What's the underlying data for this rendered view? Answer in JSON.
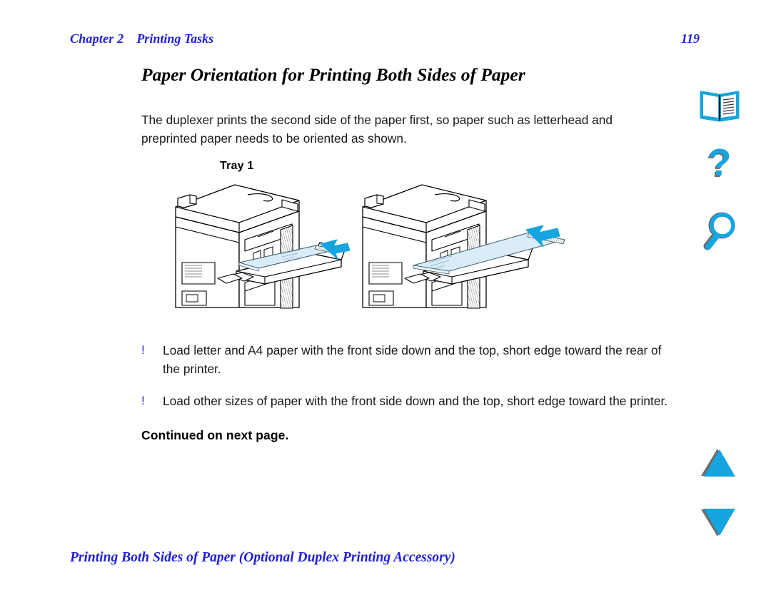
{
  "header": {
    "chapter": "Chapter 2",
    "section": "Printing Tasks",
    "page_number": "119",
    "color": "#1f1fdc"
  },
  "title": "Paper Orientation for Printing Both Sides of Paper",
  "intro": "The duplexer prints the second side of the paper first, so paper such as letterhead and preprinted paper needs to be oriented as shown.",
  "figure": {
    "tray_label": "Tray 1",
    "caption": "Two views of Tray 1 extended on the printer, each showing a sheet of paper loaded face down with a cyan arrow indicating the feed direction into the printer.",
    "paper_fill": "#d9ecf7",
    "arrow_color": "#15a5e0",
    "line_color": "#000000"
  },
  "bullets": [
    {
      "marker": "!",
      "text": "Load letter and A4 paper with the front side down and the top, short edge toward the rear of the printer."
    },
    {
      "marker": "!",
      "text": "Load other sizes of paper with the front side down and the top, short edge toward the printer."
    }
  ],
  "continued": "Continued on next page.",
  "footer": {
    "text": "Printing Both Sides of Paper (Optional Duplex Printing Accessory)",
    "color": "#1f1fdc"
  },
  "nav_rail": {
    "accent": "#15a5e0",
    "shadow": "#808080",
    "items": [
      {
        "id": "book",
        "name": "open-book-icon",
        "label": "Contents"
      },
      {
        "id": "help",
        "name": "question-mark-icon",
        "label": "Help"
      },
      {
        "id": "find",
        "name": "magnifying-glass-icon",
        "label": "Find"
      },
      {
        "id": "prev",
        "name": "triangle-up-icon",
        "label": "Previous page"
      },
      {
        "id": "next",
        "name": "triangle-down-icon",
        "label": "Next page"
      }
    ]
  }
}
